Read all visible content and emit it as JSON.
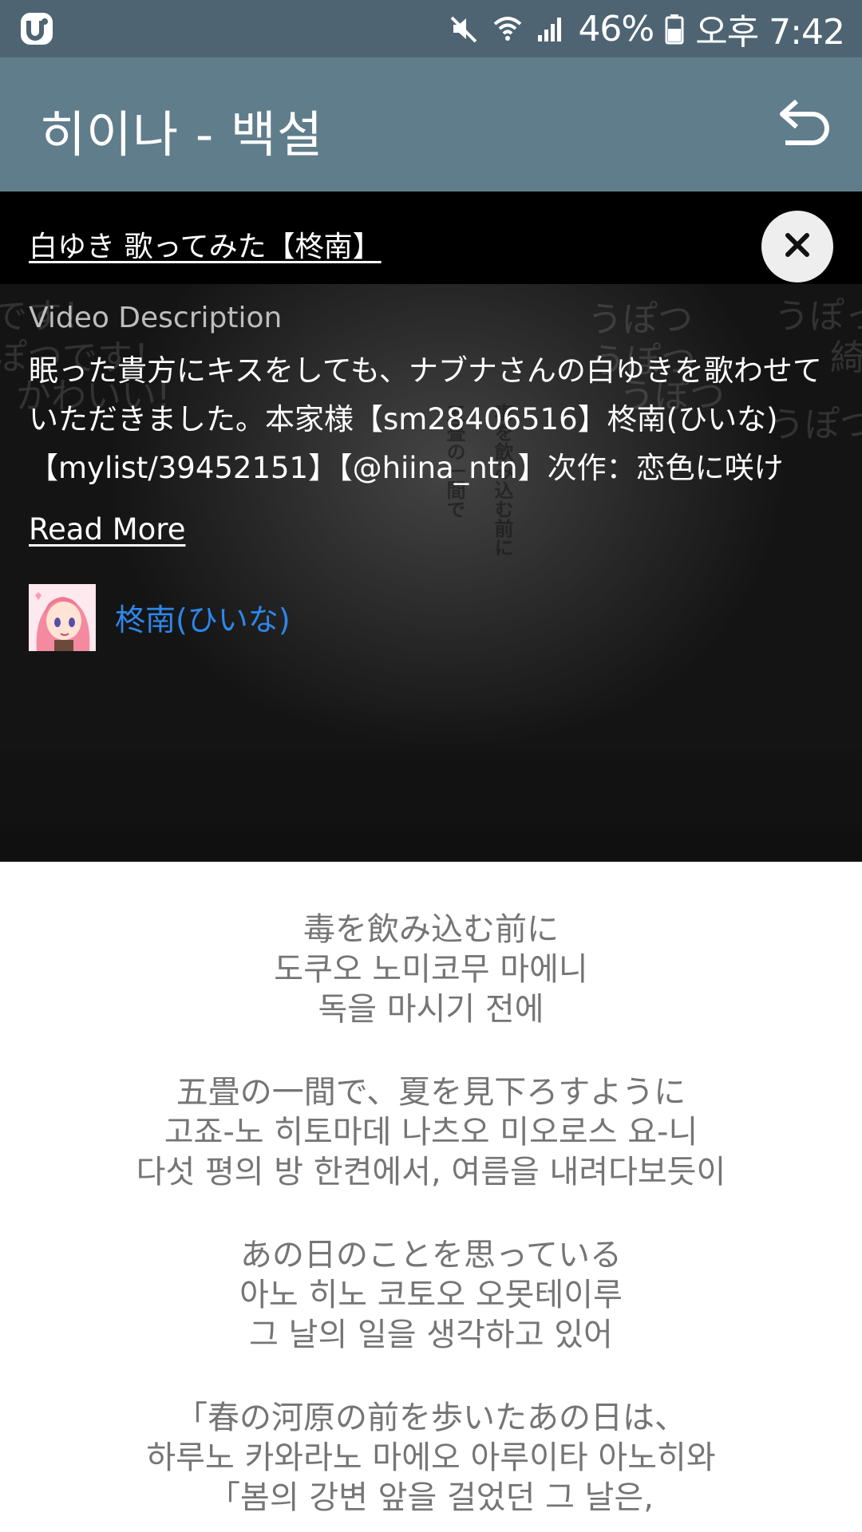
{
  "status_bar": {
    "app_icon": "u-logo-icon",
    "icons": [
      "mute-icon",
      "wifi-icon",
      "signal-icon",
      "battery-icon"
    ],
    "battery": "46%",
    "time": "오후 7:42"
  },
  "app_bar": {
    "title": "히이나 - 백설",
    "back_icon": "undo-arrow-icon"
  },
  "video": {
    "title": "白ゆき 歌ってみた【柊南】",
    "close_icon": "close-icon",
    "description_heading": "Video Description",
    "description": "眠った貴方にキスをしても、ナブナさんの白ゆきを歌わせていただきました。本家様【sm28406516】柊南(ひいな)【mylist/39452151】【@hiina_ntn】次作：恋色に咲け",
    "read_more": "Read More",
    "uploader": "柊南(ひいな)"
  },
  "lyrics": [
    [
      "毒を飲み込む前に",
      "도쿠오 노미코무 마에니",
      "독을 마시기 전에"
    ],
    [
      "五畳の一間で、夏を見下ろすように",
      "고죠-노 히토마데 나츠오 미오로스 요-니",
      "다섯 평의 방 한켠에서, 여름을 내려다보듯이"
    ],
    [
      "あの日のことを思っている",
      "아노 히노 코토오 오못테이루",
      "그 날의 일을 생각하고 있어"
    ],
    [
      "「春の河原の前を歩いたあの日は、",
      "하루노 카와라노 마에오 아루이타 아노히와",
      "「봄의 강변 앞을 걸었던 그 날은,"
    ]
  ],
  "colors": {
    "status_bar": "#4e6472",
    "app_bar": "#607d8b",
    "uploader_link": "#2f86e8",
    "lyrics_text": "#757575"
  }
}
